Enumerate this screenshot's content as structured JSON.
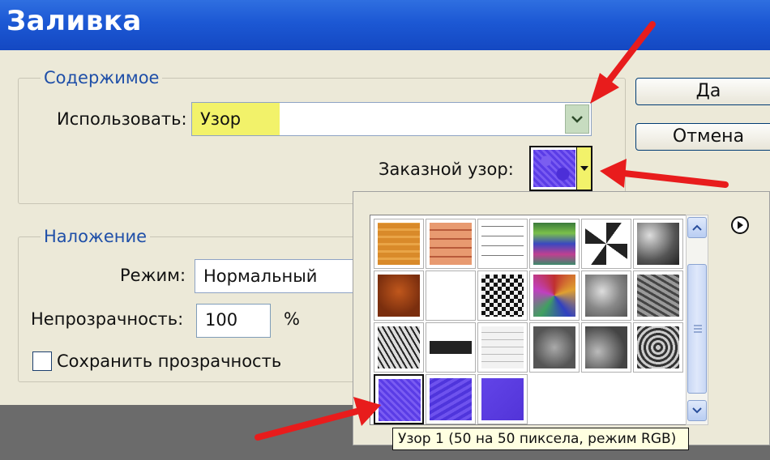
{
  "window": {
    "title": "Заливка"
  },
  "contents_group": {
    "title": "Содержимое",
    "use_label": "Использовать:",
    "use_value": "Узор",
    "custom_pattern_label": "Заказной узор:"
  },
  "blending_group": {
    "title": "Наложение",
    "mode_label": "Режим:",
    "mode_value": "Нормальный",
    "opacity_label": "Непрозрачность:",
    "opacity_value": "100",
    "opacity_unit": "%",
    "preserve_label": "Сохранить прозрачность",
    "preserve_checked": false
  },
  "buttons": {
    "ok": "Да",
    "cancel": "Отмена"
  },
  "pattern_picker": {
    "selected": "pattern-purple-1",
    "patterns": [
      "pattern-orange-wood",
      "pattern-orange-tiles",
      "pattern-white-grid",
      "pattern-rainbow-stripes",
      "pattern-bw-doodle",
      "pattern-gray-rock",
      "pattern-brown-rust",
      "pattern-concentric-squares",
      "pattern-checker-wave",
      "pattern-color-mosaic",
      "pattern-gray-blur",
      "pattern-gray-crinkle",
      "pattern-bw-crackle",
      "pattern-black-stripe",
      "pattern-white-brick",
      "pattern-gray-cloud",
      "pattern-gray-stone",
      "pattern-gray-swirl",
      "pattern-purple-1",
      "pattern-purple-2",
      "pattern-purple-3"
    ]
  },
  "tooltip": "Узор 1 (50 на 50 пиксела, режим RGB)",
  "colors": {
    "title_bar": "#1c58d4",
    "highlight": "#f2f26a",
    "arrow": "#e81c1c",
    "group_title": "#1f4fa8"
  }
}
